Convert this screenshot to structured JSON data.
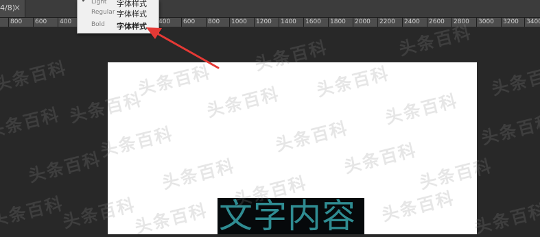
{
  "tab": {
    "title": "4/8)",
    "close_glyph": "×"
  },
  "ruler": {
    "labels": [
      "800",
      "600",
      "400",
      "200",
      "0",
      "200",
      "400",
      "600",
      "800",
      "1000",
      "1200",
      "1400",
      "1600",
      "1800",
      "2000",
      "2200",
      "2400",
      "2600",
      "2800",
      "3000",
      "3200",
      "3400"
    ]
  },
  "menu": {
    "items": [
      {
        "checked": true,
        "check_glyph": "✔",
        "weight": "Light",
        "sample": "字体样式"
      },
      {
        "checked": false,
        "check_glyph": "",
        "weight": "Regular",
        "sample": "字体样式"
      },
      {
        "checked": false,
        "check_glyph": "",
        "weight": "Bold",
        "sample": "字体样式"
      }
    ]
  },
  "watermark": {
    "text": "头条百科"
  },
  "canvas": {
    "text_content": "文字内容"
  },
  "colors": {
    "workspace": "#282828",
    "canvas": "#ffffff",
    "text_fill": "#2f8c92",
    "annotation_arrow": "#e53935"
  }
}
